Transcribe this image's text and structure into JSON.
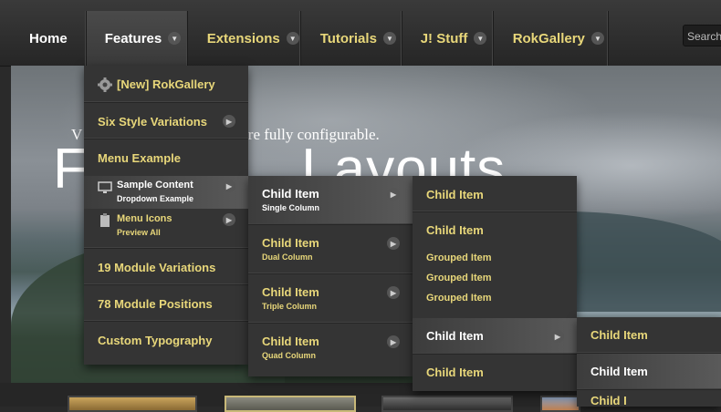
{
  "nav": {
    "items": [
      {
        "label": "Home"
      },
      {
        "label": "Features"
      },
      {
        "label": "Extensions"
      },
      {
        "label": "Tutorials"
      },
      {
        "label": "J! Stuff"
      },
      {
        "label": "RokGallery"
      }
    ]
  },
  "search": {
    "placeholder": "Search"
  },
  "hero": {
    "tagline": "are fully configurable.",
    "tagline_prefix": "V",
    "title": "Layouts",
    "title_prefix": "F"
  },
  "menu1": {
    "items": [
      {
        "label": "[New] RokGallery",
        "icon": "gear-icon"
      },
      {
        "label": "Six Style Variations"
      },
      {
        "label": "Menu Example"
      },
      {
        "label": "Sample Content",
        "sub": "Dropdown Example",
        "icon": "monitor-icon"
      },
      {
        "label": "Menu Icons",
        "sub": "Preview All",
        "icon": "clipboard-icon"
      },
      {
        "label": "19 Module Variations"
      },
      {
        "label": "78 Module Positions"
      },
      {
        "label": "Custom Typography"
      }
    ]
  },
  "menu2": {
    "items": [
      {
        "label": "Child Item",
        "sub": "Single Column"
      },
      {
        "label": "Child Item",
        "sub": "Dual Column"
      },
      {
        "label": "Child Item",
        "sub": "Triple Column"
      },
      {
        "label": "Child Item",
        "sub": "Quad Column"
      }
    ]
  },
  "menu3": {
    "items": [
      {
        "label": "Child Item"
      },
      {
        "label": "Child Item"
      },
      {
        "label": "Grouped Item"
      },
      {
        "label": "Grouped Item"
      },
      {
        "label": "Grouped Item"
      },
      {
        "label": "Child Item"
      },
      {
        "label": "Child Item"
      }
    ]
  },
  "menu4": {
    "items": [
      {
        "label": "Child Item"
      },
      {
        "label": "Child Item"
      },
      {
        "label": "Child I"
      }
    ]
  },
  "colors": {
    "accent": "#e8d77a",
    "menu_bg": "#343434",
    "nav_bg": "#2e2e2e"
  }
}
